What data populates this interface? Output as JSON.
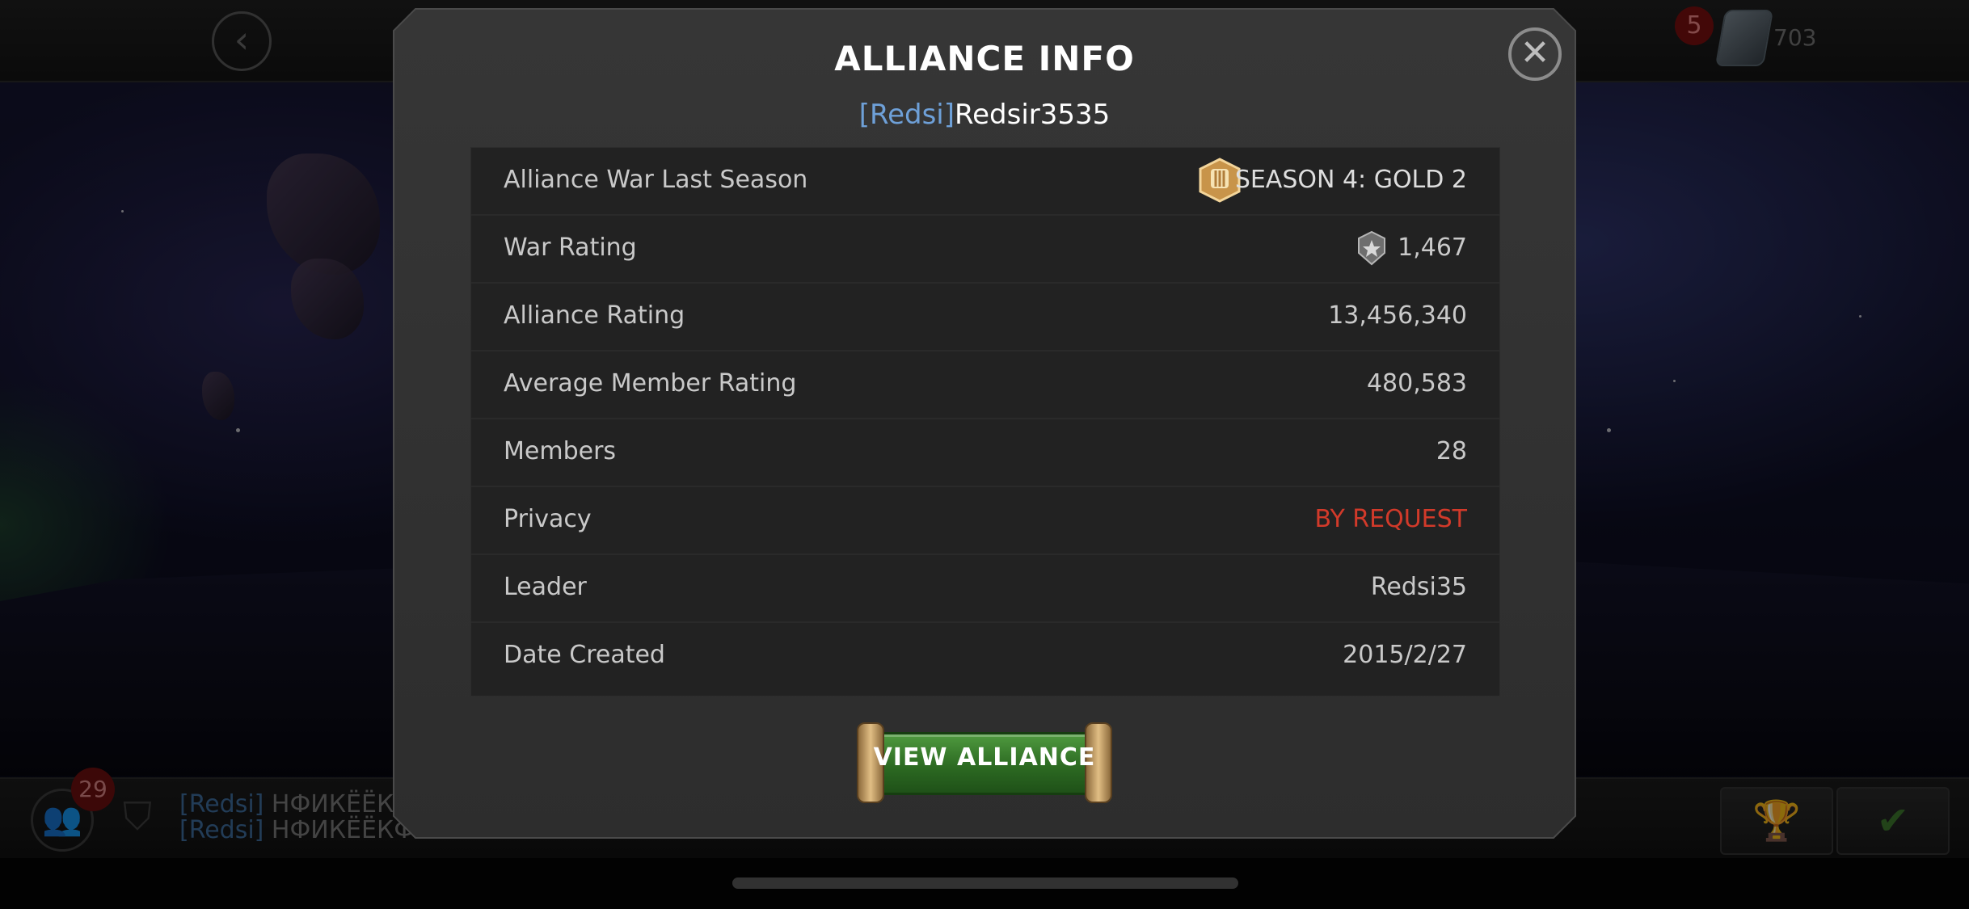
{
  "topbar": {
    "currency_amount": "703",
    "notification_count": "5"
  },
  "bottombar": {
    "members_count": "29",
    "chat": [
      {
        "tag": "[Redsi]",
        "text": "НФИКЁЁК"
      },
      {
        "tag": "[Redsi]",
        "text": "НФИКЁЁКФ"
      }
    ]
  },
  "modal": {
    "title": "ALLIANCE INFO",
    "alliance_tag": "[Redsi]",
    "alliance_name": "Redsir3535",
    "rows": [
      {
        "label": "Alliance War Last Season",
        "value": "SEASON 4: GOLD 2"
      },
      {
        "label": "War Rating",
        "value": "1,467"
      },
      {
        "label": "Alliance Rating",
        "value": "13,456,340"
      },
      {
        "label": "Average Member Rating",
        "value": "480,583"
      },
      {
        "label": "Members",
        "value": "28"
      },
      {
        "label": "Privacy",
        "value": "BY REQUEST"
      },
      {
        "label": "Leader",
        "value": "Redsi35"
      },
      {
        "label": "Date Created",
        "value": "2015/2/27"
      }
    ],
    "view_button_label": "VIEW ALLIANCE"
  },
  "colors": {
    "accent_tag": "#6ea0d8",
    "privacy_red": "#d23a2a",
    "button_green": "#2c6a22"
  }
}
